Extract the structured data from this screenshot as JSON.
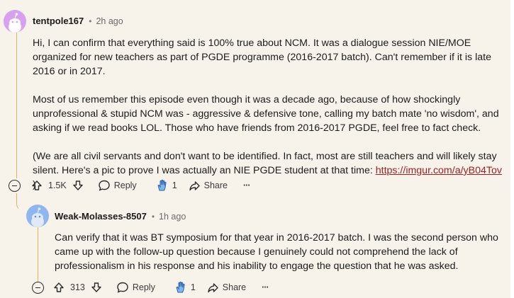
{
  "comments": [
    {
      "username": "tentpole167",
      "separator": "•",
      "time": "2h ago",
      "paragraphs": [
        "Hi, I can confirm that everything said is 100% true about NCM. It was a dialogue session NIE/MOE organized for new teachers as part of PGDE programme (2016-2017 batch). Can't remember if it is late 2016 or in 2017.",
        "Most of us remember this episode even though it was a decade ago, because of how shockingly unprofessional & stupid NCM was - aggressive & defensive tone, calling my batch mate 'no wisdom', and asking if we read books LOL. Those who have friends from 2016-2017 PGDE, feel free to fact check."
      ],
      "last_paragraph_text": "(We are all civil servants and don't want to be identified. In fact, most are still teachers and will likely stay silent. Here's a pic to prove I was actually an NIE PGDE student at that time: ",
      "link_text": "https://imgur.com/a/yB04Tov",
      "last_paragraph_end": " )",
      "upvotes": "1.5K",
      "reply_label": "Reply",
      "award_count": "1",
      "share_label": "Share",
      "more_label": "···"
    },
    {
      "username": "Weak-Molasses-8507",
      "separator": "•",
      "time": "1h ago",
      "paragraphs": [
        "Can verify that it was BT symposium for that year in 2016-2017 batch. I was the second person who came up with the follow-up question because I genuinely could not comprehend the lack of professionalism in his response and his inability to engage the question that he was asked."
      ],
      "upvotes": "313",
      "reply_label": "Reply",
      "award_count": "1",
      "share_label": "Share",
      "more_label": "···"
    }
  ],
  "colors": {
    "background": "#f7f3ea",
    "thread_line": "#d9b46a",
    "link": "#9e1e1e",
    "avatar1": "#d7a1f0",
    "avatar2": "#8fb6ef"
  }
}
